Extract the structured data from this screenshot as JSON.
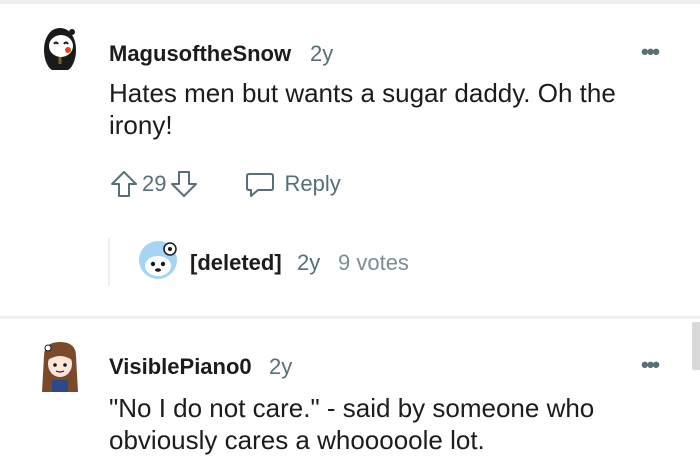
{
  "comments": [
    {
      "username": "MagusoftheSnow",
      "age": "2y",
      "body_line1": "Hates men but wants a sugar daddy. Oh the",
      "body_line2": "irony!",
      "vote_count": "29",
      "reply_label": "Reply",
      "more_label": "•••"
    },
    {
      "username": "VisiblePiano0",
      "age": "2y",
      "body_line1": "\"No I do not care.\" - said by someone who",
      "body_line2": "obviously cares a whooooole lot.",
      "more_label": "•••"
    }
  ],
  "collapsed_reply": {
    "username": "[deleted]",
    "age": "2y",
    "votes": "9 votes"
  },
  "icons": {
    "upvote": "arrow-up-outline",
    "downvote": "arrow-down-outline",
    "reply": "speech-bubble-outline",
    "more": "horizontal-ellipsis"
  },
  "colors": {
    "meta_text": "#576f76",
    "divider": "#edeff1",
    "text": "#1c1c1c"
  }
}
